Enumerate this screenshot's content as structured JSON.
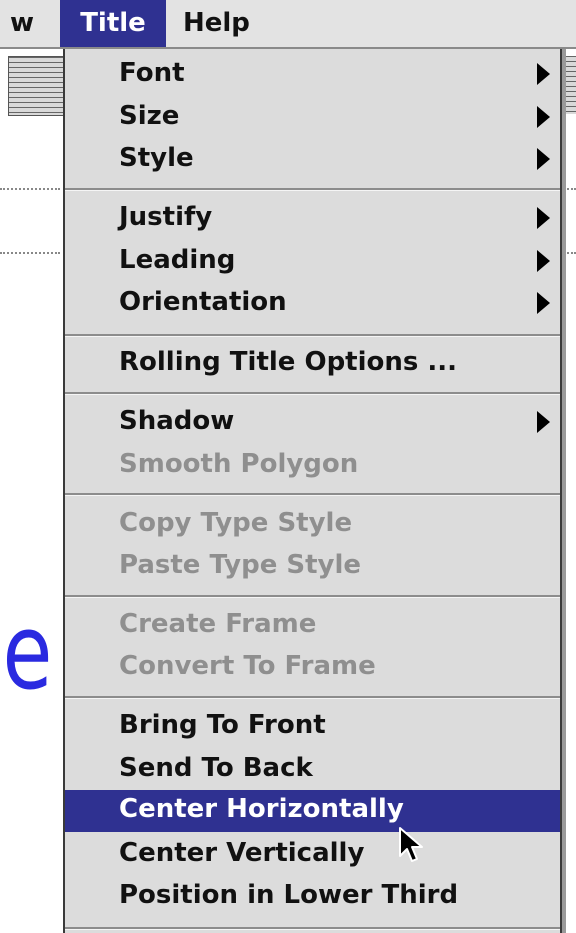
{
  "menubar": {
    "prev_menu": "w",
    "title_menu": "Title",
    "help_menu": "Help"
  },
  "background": {
    "partial_text": "le"
  },
  "menu": {
    "font": "Font",
    "size": "Size",
    "style": "Style",
    "justify": "Justify",
    "leading": "Leading",
    "orientation": "Orientation",
    "rolling": "Rolling Title Options ...",
    "shadow": "Shadow",
    "smooth": "Smooth Polygon",
    "copy_style": "Copy Type Style",
    "paste_style": "Paste Type Style",
    "create_frame": "Create Frame",
    "convert_frame": "Convert To Frame",
    "bring_front": "Bring To Front",
    "send_back": "Send To Back",
    "center_h": "Center Horizontally",
    "center_v": "Center Vertically",
    "lower_third": "Position in Lower Third"
  },
  "colors": {
    "highlight": "#2f3191",
    "menu_bg": "#dcdcdc",
    "disabled_text": "#8f8f8f",
    "canvas_text": "#2a2ae0"
  }
}
